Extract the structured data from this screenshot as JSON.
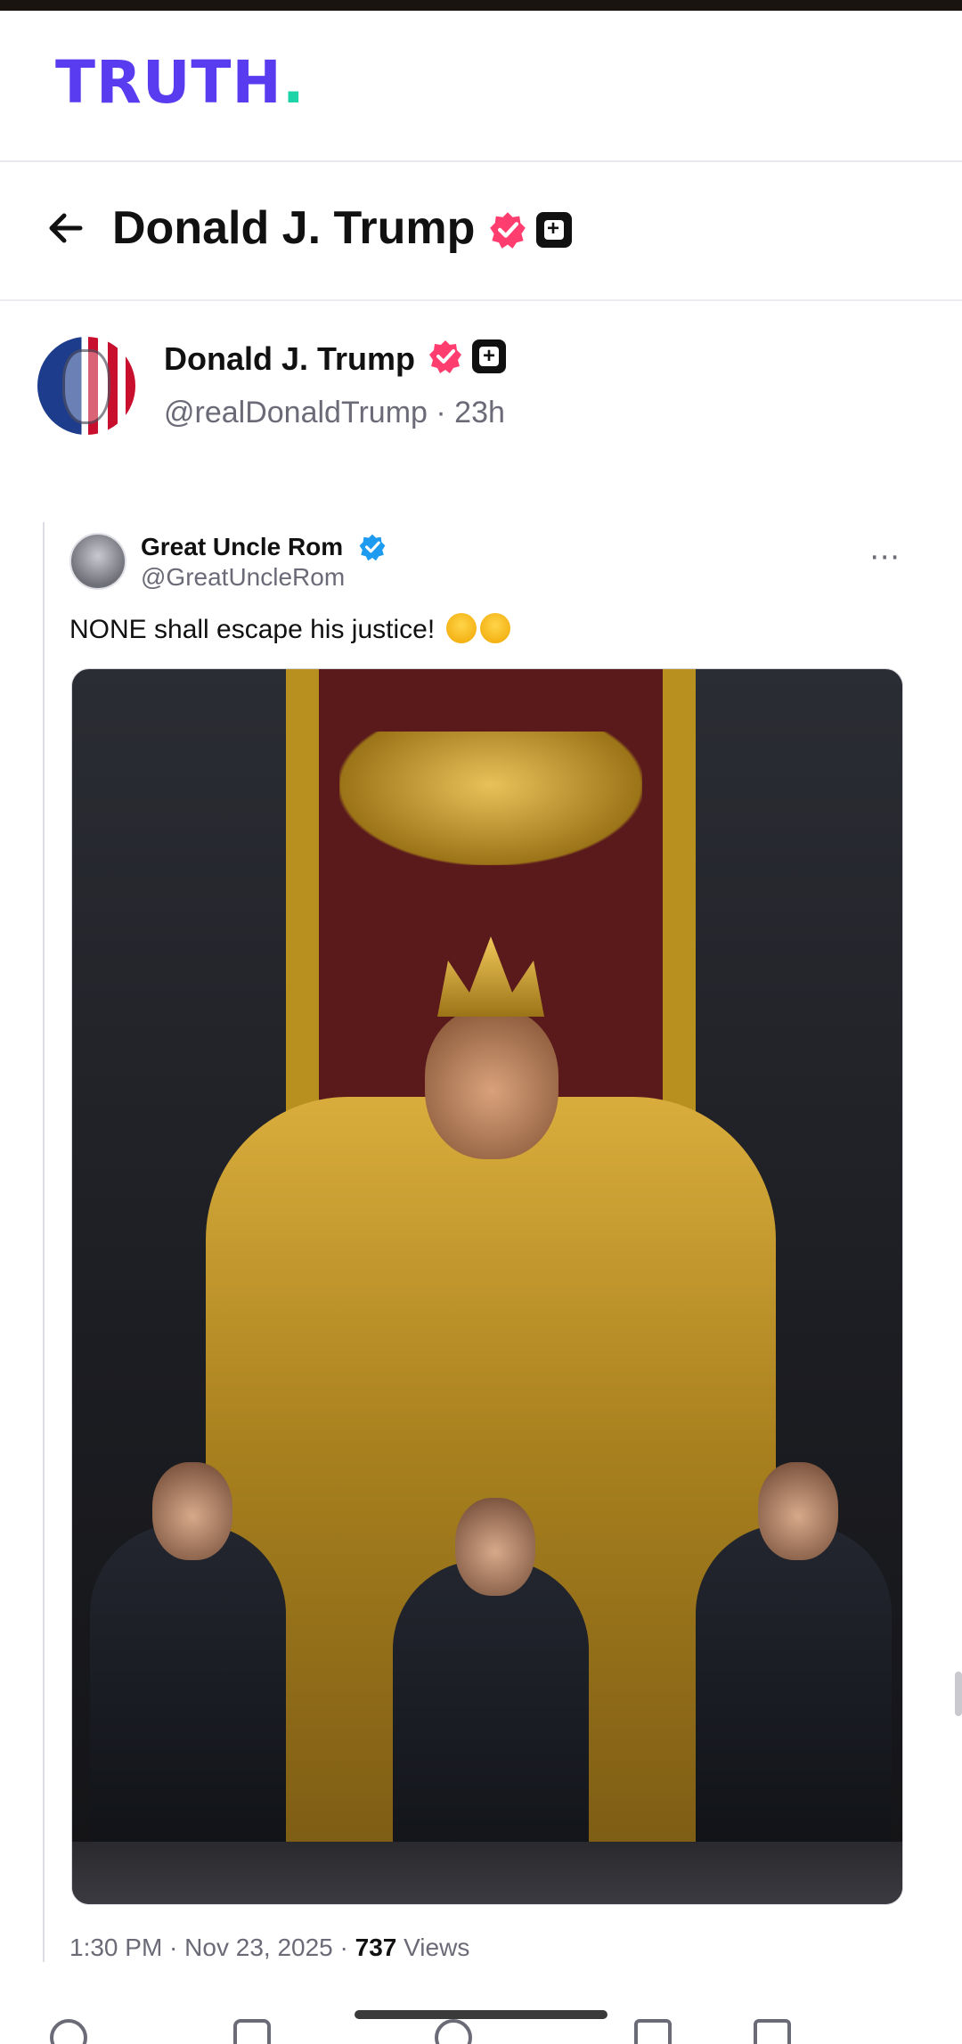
{
  "brand": {
    "logo_text": "TRUTH",
    "logo_dot": ".",
    "logo_color": "#5a3cf0",
    "dot_color": "#1dd4a8"
  },
  "nav": {
    "title": "Donald J. Trump",
    "back_icon": "arrow-left-icon"
  },
  "post": {
    "author_name": "Donald J. Trump",
    "handle": "@realDonaldTrump",
    "time": "23h",
    "verified_color": "#ff3d6e"
  },
  "quoted": {
    "name": "Great Uncle Rom",
    "handle": "@GreatUncleRom",
    "more_icon": "⋯",
    "text": "NONE shall escape his justice!",
    "verified_color": "#1d9bf0",
    "footer_time": "1:30 PM",
    "footer_date": "Nov 23, 2025",
    "views_count": "737",
    "views_label": "Views"
  },
  "separator": " · "
}
